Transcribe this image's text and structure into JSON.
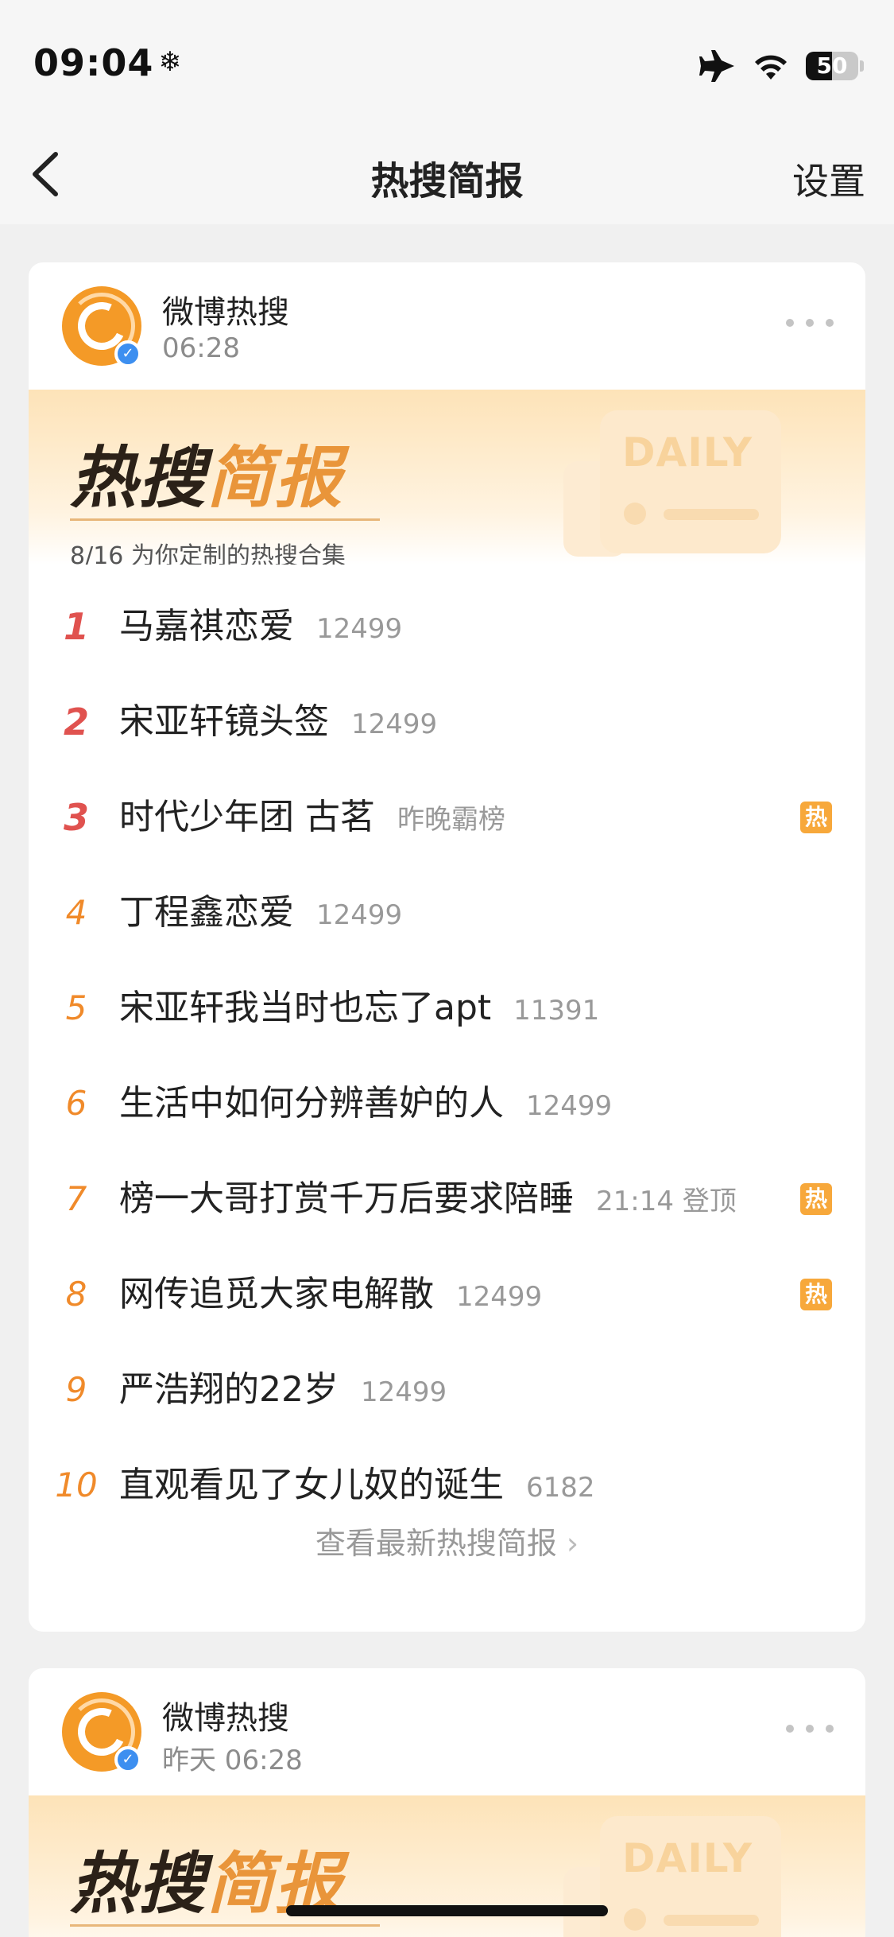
{
  "status_bar": {
    "time": "09:04",
    "snow_symbol": "❄",
    "battery_level": "50",
    "icons": [
      "airplane-icon",
      "wifi-icon",
      "battery-icon"
    ]
  },
  "nav": {
    "title": "热搜简报",
    "settings_label": "设置"
  },
  "colors": {
    "accent": "#f08a2a",
    "top_rank": "#e0524f",
    "hot_badge": "#f7a83b"
  },
  "cards": [
    {
      "name": "微博热搜",
      "time": "06:28",
      "banner_title_a": "热搜",
      "banner_title_b": "简报",
      "daily_label": "DAILY",
      "subtitle": "8/16 为你定制的热搜合集",
      "items": [
        {
          "rank": "1",
          "title": "马嘉祺恋爱",
          "meta": "12499",
          "hot": ""
        },
        {
          "rank": "2",
          "title": "宋亚轩镜头签",
          "meta": "12499",
          "hot": ""
        },
        {
          "rank": "3",
          "title": "时代少年团 古茗",
          "meta": "昨晚霸榜",
          "hot": "热"
        },
        {
          "rank": "4",
          "title": "丁程鑫恋爱",
          "meta": "12499",
          "hot": ""
        },
        {
          "rank": "5",
          "title": "宋亚轩我当时也忘了apt",
          "meta": "11391",
          "hot": ""
        },
        {
          "rank": "6",
          "title": "生活中如何分辨善妒的人",
          "meta": "12499",
          "hot": ""
        },
        {
          "rank": "7",
          "title": "榜一大哥打赏千万后要求陪睡",
          "meta": "21:14 登顶",
          "hot": "热"
        },
        {
          "rank": "8",
          "title": "网传追觅大家电解散",
          "meta": "12499",
          "hot": "热"
        },
        {
          "rank": "9",
          "title": "严浩翔的22岁",
          "meta": "12499",
          "hot": ""
        },
        {
          "rank": "10",
          "title": "直观看见了女儿奴的诞生",
          "meta": "6182",
          "hot": ""
        }
      ],
      "view_more": "查看最新热搜简报"
    },
    {
      "name": "微博热搜",
      "time": "昨天 06:28",
      "banner_title_a": "热搜",
      "banner_title_b": "简报",
      "daily_label": "DAILY"
    }
  ]
}
